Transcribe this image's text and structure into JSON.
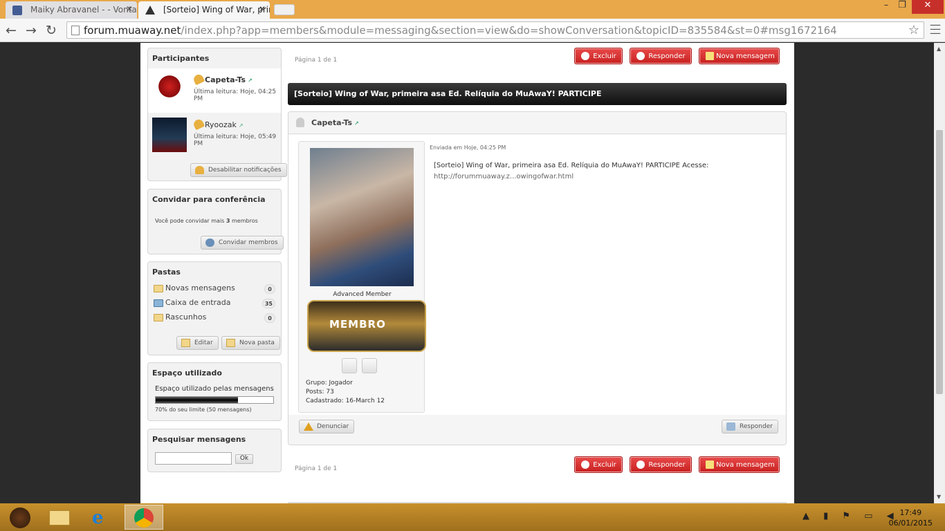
{
  "browser": {
    "tabs": [
      {
        "label": "Maiky Abravanel - - Vonta",
        "active": false
      },
      {
        "label": "[Sorteio] Wing of War, prim",
        "active": true
      }
    ],
    "url_host": "forum.muaway.net",
    "url_path": "/index.php?app=members&module=messaging&section=view&do=showConversation&topicID=835584&st=0#msg1672164"
  },
  "sidebar": {
    "participants": {
      "title": "Participantes",
      "list": [
        {
          "name": "Capeta-Ts",
          "last_read": "Última leitura: Hoje, 04:25 PM"
        },
        {
          "name": "Ryoozak",
          "last_read": "Última leitura: Hoje, 05:49 PM"
        }
      ],
      "disable_notifications": "Desabilitar notificações"
    },
    "invite": {
      "title": "Convidar para conferência",
      "text_prefix": "Você pode convidar mais ",
      "count": "3",
      "text_suffix": " membros",
      "button": "Convidar membros"
    },
    "folders": {
      "title": "Pastas",
      "items": [
        {
          "label": "Novas mensagens",
          "count": "0"
        },
        {
          "label": "Caixa de entrada",
          "count": "35"
        },
        {
          "label": "Rascunhos",
          "count": "0"
        }
      ],
      "edit": "Editar",
      "new_folder": "Nova pasta"
    },
    "space": {
      "title": "Espaço utilizado",
      "label": "Espaço utilizado pelas mensagens",
      "percent": 70,
      "caption": "70% do seu limite (50 mensagens)"
    },
    "search": {
      "title": "Pesquisar mensagens",
      "placeholder": "",
      "button": "Ok"
    }
  },
  "actions": {
    "delete": "Excluir",
    "reply": "Responder",
    "new_message": "Nova mensagem",
    "pager": "Página 1 de 1"
  },
  "topic": {
    "title": "[Sorteio] Wing of War, primeira asa Ed. Relíquia do MuAwaY! PARTICIPE"
  },
  "post": {
    "author": "Capeta-Ts",
    "rank": "Advanced Member",
    "badge": "MEMBRO",
    "group": "Grupo: Jogador",
    "posts": "Posts: 73",
    "joined": "Cadastrado: 16-March 12",
    "sent": "Enviada em Hoje, 04:25 PM",
    "text": "[Sorteio] Wing of War, primeira asa Ed. Relíquia do MuAwaY! PARTICIPE Acesse:",
    "link": "http://forummuaway.z...owingofwar.html",
    "report": "Denunciar",
    "reply": "Responder"
  },
  "taskbar": {
    "time": "17:49",
    "date": "06/01/2015"
  },
  "colors": {
    "accent_red": "#c81f1f",
    "titlebar": "#e9a84a",
    "taskbar": "#b07e26"
  }
}
